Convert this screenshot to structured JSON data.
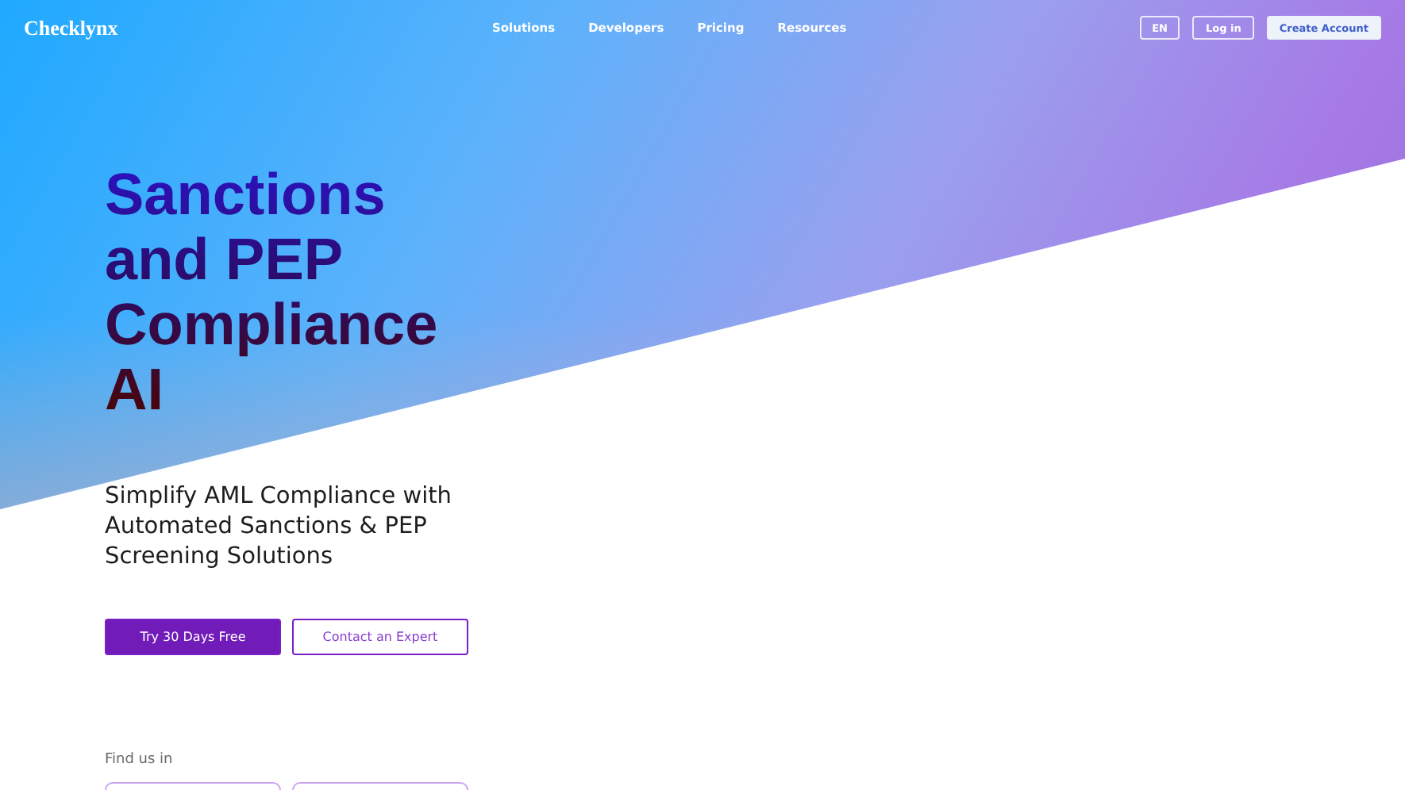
{
  "brand": "Checklynx",
  "nav": [
    {
      "label": "Solutions"
    },
    {
      "label": "Developers"
    },
    {
      "label": "Pricing"
    },
    {
      "label": "Resources"
    }
  ],
  "header_actions": {
    "language": "EN",
    "login": "Log in",
    "signup": "Create Account"
  },
  "hero": {
    "title_lines": [
      "Sanctions",
      "and PEP",
      "Compliance",
      "AI"
    ],
    "subtitle": "Simplify AML Compliance with Automated Sanctions & PEP Screening Solutions",
    "buttons": [
      {
        "label": "Try 30 Days Free",
        "kind": "primary"
      },
      {
        "label": "Contact an Expert",
        "kind": "outline"
      }
    ],
    "find_us": "Find us in"
  }
}
